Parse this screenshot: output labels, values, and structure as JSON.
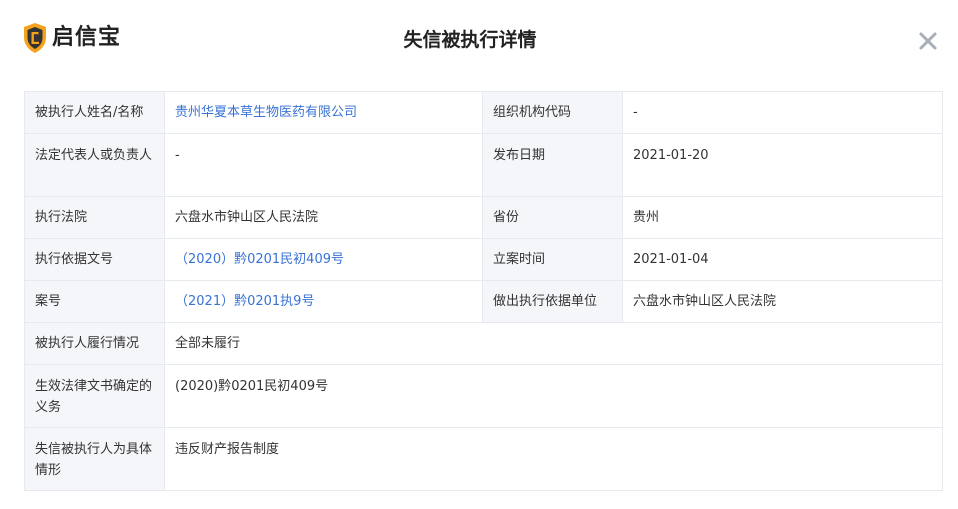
{
  "brand": {
    "name": "启信宝",
    "accent": "#f4a21d",
    "shield_dark": "#333333"
  },
  "dialog": {
    "title": "失信被执行详情",
    "close_label": "×"
  },
  "details": {
    "executed_name": {
      "label": "被执行人姓名/名称",
      "value": "贵州华夏本草生物医药有限公司"
    },
    "org_code": {
      "label": "组织机构代码",
      "value": "-"
    },
    "legal_rep": {
      "label": "法定代表人或负责人",
      "value": "-"
    },
    "publish_date": {
      "label": "发布日期",
      "value": "2021-01-20"
    },
    "court": {
      "label": "执行法院",
      "value": "六盘水市钟山区人民法院"
    },
    "province": {
      "label": "省份",
      "value": "贵州"
    },
    "basis_doc_no": {
      "label": "执行依据文号",
      "value": "（2020）黔0201民初409号"
    },
    "filing_date": {
      "label": "立案时间",
      "value": "2021-01-04"
    },
    "case_no": {
      "label": "案号",
      "value": "（2021）黔0201执9号"
    },
    "basis_unit": {
      "label": "做出执行依据单位",
      "value": "六盘水市钟山区人民法院"
    },
    "performance": {
      "label": "被执行人履行情况",
      "value": "全部未履行"
    },
    "obligation": {
      "label": "生效法律文书确定的义务",
      "value": "(2020)黔0201民初409号"
    },
    "situation": {
      "label": "失信被执行人为具体情形",
      "value": "违反财产报告制度"
    }
  }
}
